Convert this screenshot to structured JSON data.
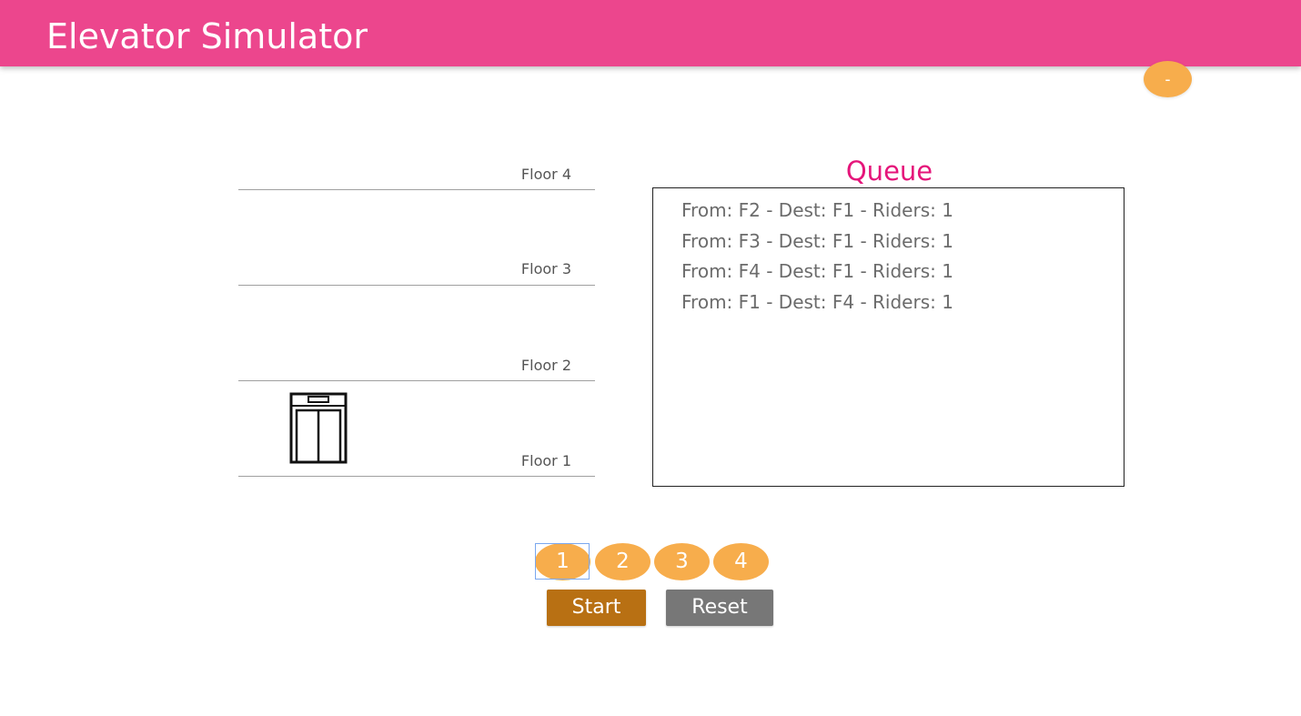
{
  "app_bar": {
    "title": "Elevator Simulator",
    "color": "#ec468d"
  },
  "fab": {
    "label": "-",
    "color": "#f7ad4c"
  },
  "building": {
    "floors": [
      {
        "label": "Floor 4"
      },
      {
        "label": "Floor 3"
      },
      {
        "label": "Floor 2"
      },
      {
        "label": "Floor 1"
      }
    ],
    "elevator_current_floor": 1
  },
  "queue": {
    "title": "Queue",
    "title_color": "#e5157a",
    "items": [
      "From: F2 - Dest: F1 - Riders: 1",
      "From: F3 - Dest: F1 - Riders: 1",
      "From: F4 - Dest: F1 - Riders: 1",
      "From: F1 - Dest: F4 - Riders: 1"
    ]
  },
  "floor_buttons": {
    "labels": [
      "1",
      "2",
      "3",
      "4"
    ],
    "focused": "1",
    "color": "#f7ad4c"
  },
  "controls": {
    "start_label": "Start",
    "start_color": "#b87013",
    "reset_label": "Reset",
    "reset_color": "#777777"
  }
}
